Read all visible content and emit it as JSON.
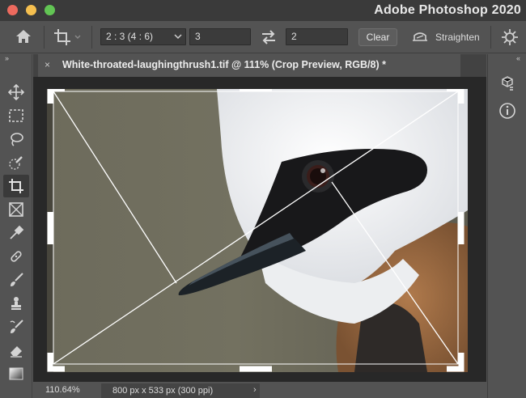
{
  "window": {
    "app_title": "Adobe Photoshop 2020"
  },
  "options_bar": {
    "aspect_ratio": "2 : 3 (4 : 6)",
    "width_value": "3",
    "height_value": "2",
    "clear_label": "Clear",
    "straighten_label": "Straighten"
  },
  "document": {
    "tab_title": "White-throated-laughingthrush1.tif @ 111% (Crop Preview, RGB/8) *",
    "close_glyph": "×"
  },
  "status": {
    "zoom": "110.64%",
    "doc_info": "800 px x 533 px (300 ppi)"
  },
  "toolbar": {
    "tools": [
      "move-tool",
      "marquee-tool",
      "lasso-tool",
      "quick-selection-tool",
      "crop-tool",
      "frame-tool",
      "eyedropper-tool",
      "healing-brush-tool",
      "brush-tool",
      "clone-stamp-tool",
      "history-brush-tool",
      "eraser-tool",
      "gradient-tool"
    ],
    "active_tool": "crop-tool"
  },
  "right_panel": {
    "icons": [
      "libraries-icon",
      "info-icon"
    ]
  },
  "colors": {
    "ui_background": "#535353",
    "titlebar": "#3a3a3a",
    "canvas_background": "#282828"
  }
}
